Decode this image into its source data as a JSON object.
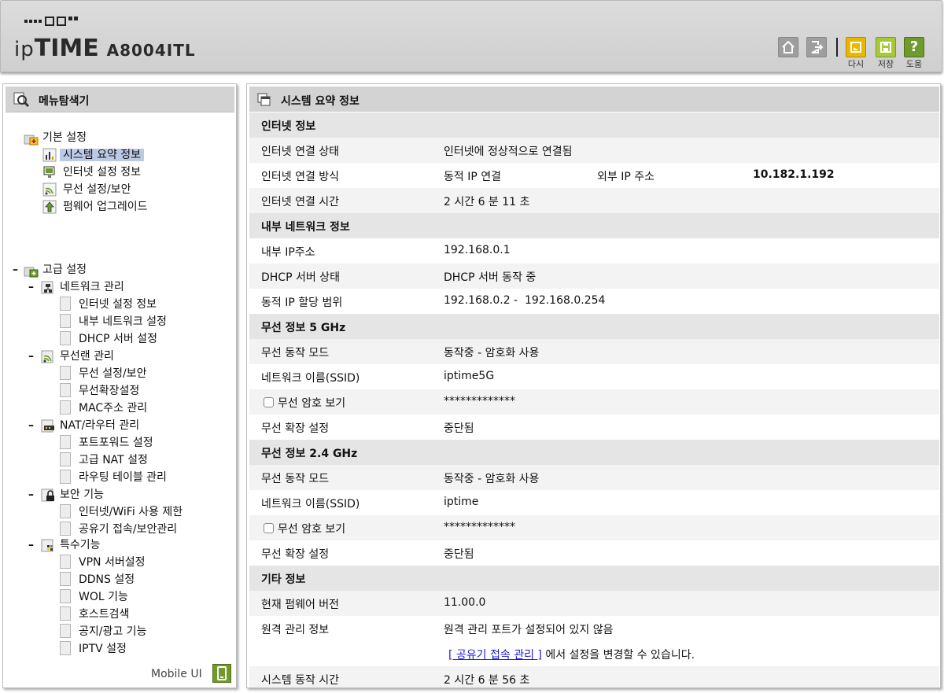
{
  "header": {
    "brand_main": "ipTIME",
    "model": "A8004ITL",
    "buttons": [
      {
        "label": ""
      },
      {
        "label": ""
      },
      {
        "label": "다시"
      },
      {
        "label": "저장"
      },
      {
        "label": "도움"
      }
    ]
  },
  "colors": {
    "accent_green": "#6f9a2d",
    "accent_yellow": "#e6b200",
    "selected_bg": "#bcc9e6",
    "link": "#1a1adb"
  },
  "left": {
    "title": "메뉴탐색기",
    "basic": {
      "label": "기본 설정",
      "items": [
        "시스템 요약 정보",
        "인터넷 설정 정보",
        "무선 설정/보안",
        "펌웨어 업그레이드"
      ]
    },
    "advanced": {
      "label": "고급 설정",
      "groups": [
        {
          "label": "네트워크 관리",
          "items": [
            "인터넷 설정 정보",
            "내부 네트워크 설정",
            "DHCP 서버 설정"
          ]
        },
        {
          "label": "무선랜 관리",
          "items": [
            "무선 설정/보안",
            "무선확장설정",
            "MAC주소 관리"
          ]
        },
        {
          "label": "NAT/라우터 관리",
          "items": [
            "포트포워드 설정",
            "고급 NAT 설정",
            "라우팅 테이블 관리"
          ]
        },
        {
          "label": "보안 기능",
          "items": [
            "인터넷/WiFi 사용 제한",
            "공유기 접속/보안관리"
          ]
        },
        {
          "label": "특수기능",
          "items": [
            "VPN 서버설정",
            "DDNS 설정",
            "WOL 기능",
            "호스트검색",
            "공지/광고 기능",
            "IPTV 설정"
          ]
        }
      ]
    },
    "mobile_ui": "Mobile UI"
  },
  "main": {
    "title": "시스템 요약 정보",
    "internet": {
      "title": "인터넷 정보",
      "status_label": "인터넷 연결 상태",
      "status_value": "인터넷에 정상적으로 연결됨",
      "method_label": "인터넷 연결 방식",
      "method_value": "동적 IP 연결",
      "ext_ip_label": "외부 IP 주소",
      "ext_ip_value": "10.182.1.192",
      "time_label": "인터넷 연결 시간",
      "time_value": "2 시간 6 분 11 초"
    },
    "lan": {
      "title": "내부 네트워크 정보",
      "ip_label": "내부 IP주소",
      "ip_value": "192.168.0.1",
      "dhcp_label": "DHCP 서버 상태",
      "dhcp_value": "DHCP 서버 동작 중",
      "range_label": "동적 IP 할당 범위",
      "range_value": "192.168.0.2 -  192.168.0.254"
    },
    "w5": {
      "title": "무선 정보 5 GHz",
      "mode_label": "무선 동작 모드",
      "mode_value": "동작중 - 암호화 사용",
      "ssid_label": "네트워크 이름(SSID)",
      "ssid_value": "iptime5G",
      "pw_label": "무선 암호 보기",
      "pw_value": "*************",
      "ext_label": "무선 확장 설정",
      "ext_value": "중단됨"
    },
    "w24": {
      "title": "무선 정보 2.4 GHz",
      "mode_label": "무선 동작 모드",
      "mode_value": "동작중 - 암호화 사용",
      "ssid_label": "네트워크 이름(SSID)",
      "ssid_value": "iptime",
      "pw_label": "무선 암호 보기",
      "pw_value": "*************",
      "ext_label": "무선 확장 설정",
      "ext_value": "중단됨"
    },
    "etc": {
      "title": "기타 정보",
      "fw_label": "현재 펌웨어 버전",
      "fw_value": "11.00.0",
      "remote_label": "원격 관리 정보",
      "remote_value": "원격 관리 포트가 설정되어 있지 않음",
      "remote_link": "[ 공유기 접속 관리 ]",
      "remote_link_suffix": " 에서 설정을 변경할 수 있습니다.",
      "uptime_label": "시스템 동작 시간",
      "uptime_value": "2 시간 6 분 56 초"
    }
  }
}
